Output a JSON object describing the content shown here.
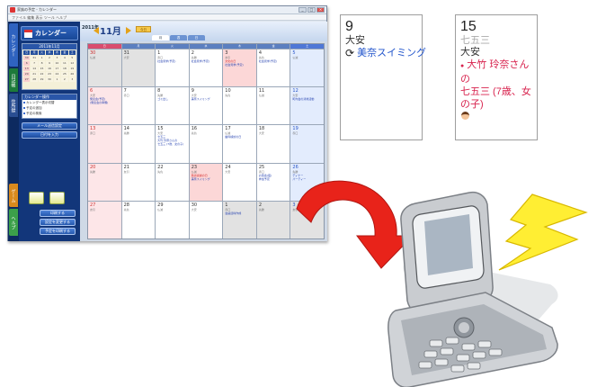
{
  "window": {
    "title": "家族の予定 - カレンダー",
    "menu": "ファイル 編集 表示 ツール ヘルプ",
    "controls": [
      "_",
      "□",
      "×"
    ]
  },
  "sidebar": {
    "logo": "カレンダー",
    "vertical_tabs": [
      "カレンダー",
      "日記帳",
      "住所録",
      "ゲーム",
      "ヘルプ"
    ],
    "mini_calendar_title": "2011年11月",
    "mini_weekdays": [
      "日",
      "月",
      "火",
      "水",
      "木",
      "金",
      "土"
    ],
    "mini_days": [
      "30",
      "31",
      "1",
      "2",
      "3",
      "4",
      "5",
      "6",
      "7",
      "8",
      "9",
      "10",
      "11",
      "12",
      "13",
      "14",
      "15",
      "16",
      "17",
      "18",
      "19",
      "20",
      "21",
      "22",
      "23",
      "24",
      "25",
      "26",
      "27",
      "28",
      "29",
      "30",
      "1",
      "2",
      "3"
    ],
    "panel_title": "カレンダー操作",
    "panel_items": [
      "カレンダー表示切替",
      "予定の追加",
      "予定の検索"
    ],
    "buttons": [
      "メール送信設定",
      "日付を入力"
    ],
    "bottom_buttons": [
      "印刷する",
      "設定を変更する",
      "予定を印刷する"
    ]
  },
  "header": {
    "year": "2011年",
    "month": "11月",
    "today_button": "今日",
    "view_tabs": [
      "月",
      "週",
      "日"
    ]
  },
  "calendar": {
    "weekdays": [
      "日",
      "月",
      "火",
      "水",
      "木",
      "金",
      "土"
    ],
    "weeks": [
      [
        {
          "day": "30",
          "rokuyo": "仏滅",
          "type": "other-sun",
          "events": []
        },
        {
          "day": "31",
          "rokuyo": "大安",
          "type": "other",
          "events": []
        },
        {
          "day": "1",
          "rokuyo": "赤口",
          "type": "",
          "events": [
            "社会見学(予定)"
          ]
        },
        {
          "day": "2",
          "rokuyo": "先勝",
          "type": "",
          "events": [
            "社会見学(予定)"
          ]
        },
        {
          "day": "3",
          "rokuyo": "友引",
          "type": "hol",
          "events": [
            "文化の日",
            "社会見学(予定)"
          ]
        },
        {
          "day": "4",
          "rokuyo": "先負",
          "type": "",
          "events": [
            "社会見学(予定)"
          ]
        },
        {
          "day": "5",
          "rokuyo": "仏滅",
          "type": "sat",
          "events": []
        }
      ],
      [
        {
          "day": "6",
          "rokuyo": "大安",
          "type": "sun",
          "events": [
            "発表会(予定)",
            "(発表会の準備)"
          ]
        },
        {
          "day": "7",
          "rokuyo": "赤口",
          "type": "",
          "events": []
        },
        {
          "day": "8",
          "rokuyo": "先勝",
          "type": "",
          "events": [
            "ゴミ出し"
          ]
        },
        {
          "day": "9",
          "rokuyo": "大安",
          "type": "",
          "events": [
            "美奈スイミング"
          ]
        },
        {
          "day": "10",
          "rokuyo": "先負",
          "type": "",
          "events": []
        },
        {
          "day": "11",
          "rokuyo": "仏滅",
          "type": "",
          "events": []
        },
        {
          "day": "12",
          "rokuyo": "大安",
          "type": "sat",
          "events": [
            "町内会の清掃活動"
          ]
        }
      ],
      [
        {
          "day": "13",
          "rokuyo": "赤口",
          "type": "sun",
          "events": []
        },
        {
          "day": "14",
          "rokuyo": "先勝",
          "type": "",
          "events": []
        },
        {
          "day": "15",
          "rokuyo": "大安",
          "type": "",
          "events": [
            "七五三",
            "大竹 玲奈さんの",
            "七五三 (7歳、女の子)"
          ]
        },
        {
          "day": "16",
          "rokuyo": "先負",
          "type": "",
          "events": []
        },
        {
          "day": "17",
          "rokuyo": "仏滅",
          "type": "",
          "events": [
            "歯科検診の日"
          ]
        },
        {
          "day": "18",
          "rokuyo": "大安",
          "type": "",
          "events": []
        },
        {
          "day": "19",
          "rokuyo": "赤口",
          "type": "sat",
          "events": []
        }
      ],
      [
        {
          "day": "20",
          "rokuyo": "先勝",
          "type": "sun",
          "events": []
        },
        {
          "day": "21",
          "rokuyo": "友引",
          "type": "",
          "events": []
        },
        {
          "day": "22",
          "rokuyo": "先負",
          "type": "",
          "events": []
        },
        {
          "day": "23",
          "rokuyo": "仏滅",
          "type": "hol",
          "events": [
            "勤労感謝の日",
            "美奈スイミング"
          ]
        },
        {
          "day": "24",
          "rokuyo": "大安",
          "type": "",
          "events": []
        },
        {
          "day": "25",
          "rokuyo": "赤口",
          "type": "",
          "events": [
            "お茶会(夜)",
            "参加予定"
          ]
        },
        {
          "day": "26",
          "rokuyo": "先勝",
          "type": "sat",
          "events": [
            "ディナー",
            "パーティー"
          ]
        }
      ],
      [
        {
          "day": "27",
          "rokuyo": "友引",
          "type": "sun",
          "events": []
        },
        {
          "day": "28",
          "rokuyo": "先負",
          "type": "",
          "events": []
        },
        {
          "day": "29",
          "rokuyo": "仏滅",
          "type": "",
          "events": []
        },
        {
          "day": "30",
          "rokuyo": "大安",
          "type": "",
          "events": []
        },
        {
          "day": "1",
          "rokuyo": "赤口",
          "type": "other",
          "events": [
            "会議資料作成"
          ]
        },
        {
          "day": "2",
          "rokuyo": "先勝",
          "type": "other",
          "events": []
        },
        {
          "day": "3",
          "rokuyo": "友引",
          "type": "other-sat",
          "events": []
        }
      ]
    ]
  },
  "zoom_cards": {
    "card9": {
      "day": "9",
      "rokuyo": "大安",
      "event": "美奈スイミング"
    },
    "card15": {
      "day": "15",
      "label": "七五三",
      "rokuyo": "大安",
      "event_line1": "大竹 玲奈さんの",
      "event_line2": "七五三 (7歳、女の子)"
    }
  },
  "colors": {
    "arrow": "#e8231a",
    "lightning": "#ffee33",
    "sidebar": "#12367a"
  }
}
